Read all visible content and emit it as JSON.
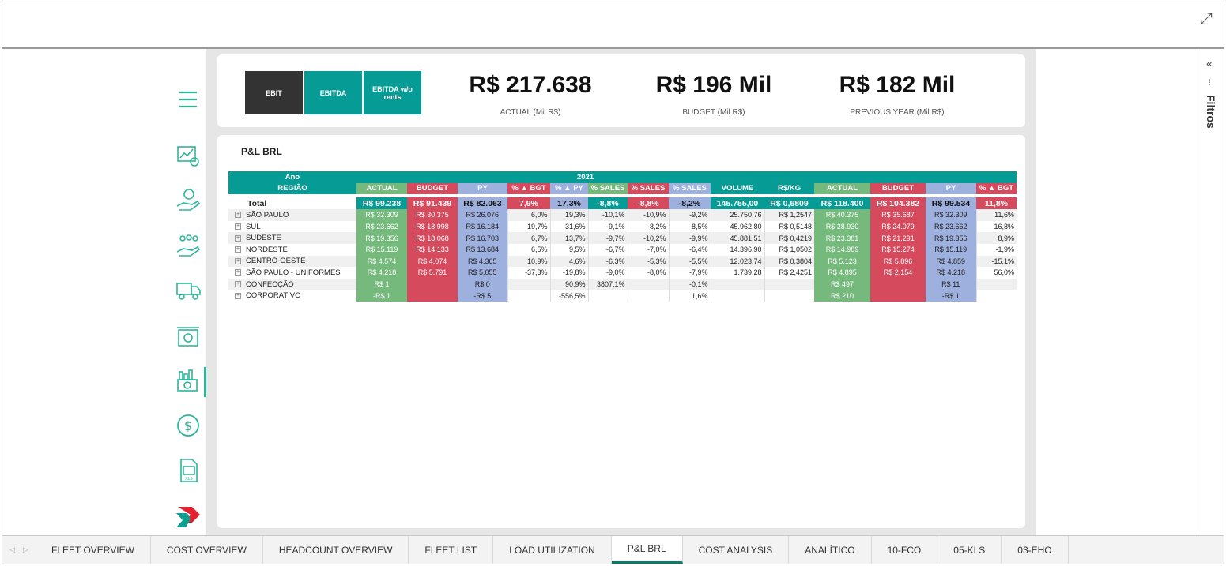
{
  "tabs_bar": [
    "FLEET OVERVIEW",
    "COST OVERVIEW",
    "HEADCOUNT OVERVIEW",
    "FLEET LIST",
    "LOAD UTILIZATION",
    "P&L BRL",
    "COST ANALYSIS",
    "ANALÍTICO",
    "10-FCO",
    "05-KLS",
    "03-EHO"
  ],
  "active_tab": "P&L BRL",
  "filters_label": "Filtros",
  "metric_buttons": {
    "ebit": "EBIT",
    "ebitda": "EBITDA",
    "ebitda_wo": "EBITDA w/o rents"
  },
  "kpis": {
    "actual": {
      "value": "R$ 217.638",
      "label": "ACTUAL (Mil R$)"
    },
    "budget": {
      "value": "R$ 196 Mil",
      "label": "BUDGET (Mil R$)"
    },
    "previous": {
      "value": "R$ 182 Mil",
      "label": "PREVIOUS YEAR (Mil R$)"
    }
  },
  "panel_title": "P&L BRL",
  "table": {
    "ano_label": "Ano",
    "regiao_label": "REGIÃO",
    "year": "2021",
    "headers": [
      "ACTUAL",
      "BUDGET",
      "PY",
      "% ▲ BGT",
      "% ▲ PY",
      "% SALES",
      "% SALES",
      "% SALES",
      "VOLUME",
      "R$/KG",
      "ACTUAL",
      "BUDGET",
      "PY",
      "% ▲ BGT"
    ],
    "total": {
      "label": "Total",
      "cells": [
        "R$ 99.238",
        "R$ 91.439",
        "R$ 82.063",
        "7,9%",
        "17,3%",
        "-8,8%",
        "-8,8%",
        "-8,2%",
        "145.755,00",
        "R$ 0,6809",
        "R$ 118.400",
        "R$ 104.382",
        "R$ 99.534",
        "11,8%"
      ]
    },
    "rows": [
      {
        "label": "SÃO PAULO",
        "cells": [
          "R$ 32.309",
          "R$ 30.375",
          "R$ 26.076",
          "6,0%",
          "19,3%",
          "-10,1%",
          "-10,9%",
          "-9,2%",
          "25.750,76",
          "R$ 1,2547",
          "R$ 40.375",
          "R$ 35.687",
          "R$ 32.309",
          "11,6%"
        ]
      },
      {
        "label": "SUL",
        "cells": [
          "R$ 23.662",
          "R$ 18.998",
          "R$ 16.184",
          "19,7%",
          "31,6%",
          "-9,1%",
          "-8,2%",
          "-8,5%",
          "45.962,80",
          "R$ 0,5148",
          "R$ 28.930",
          "R$ 24.079",
          "R$ 23.662",
          "16,8%"
        ]
      },
      {
        "label": "SUDESTE",
        "cells": [
          "R$ 19.356",
          "R$ 18.068",
          "R$ 16.703",
          "6,7%",
          "13,7%",
          "-9,7%",
          "-10,2%",
          "-9,9%",
          "45.881,51",
          "R$ 0,4219",
          "R$ 23.381",
          "R$ 21.291",
          "R$ 19.356",
          "8,9%"
        ]
      },
      {
        "label": "NORDESTE",
        "cells": [
          "R$ 15.119",
          "R$ 14.133",
          "R$ 13.684",
          "6,5%",
          "9,5%",
          "-6,7%",
          "-7,0%",
          "-6,4%",
          "14.396,90",
          "R$ 1,0502",
          "R$ 14.989",
          "R$ 15.274",
          "R$ 15.119",
          "-1,9%"
        ]
      },
      {
        "label": "CENTRO-OESTE",
        "cells": [
          "R$ 4.574",
          "R$ 4.074",
          "R$ 4.365",
          "10,9%",
          "4,6%",
          "-6,3%",
          "-5,3%",
          "-5,5%",
          "12.023,74",
          "R$ 0,3804",
          "R$ 5.123",
          "R$ 5.896",
          "R$ 4.859",
          "-15,1%"
        ]
      },
      {
        "label": "SÃO PAULO - UNIFORMES",
        "cells": [
          "R$ 4.218",
          "R$ 5.791",
          "R$ 5.055",
          "-37,3%",
          "-19,8%",
          "-9,0%",
          "-8,0%",
          "-7,9%",
          "1.739,28",
          "R$ 2,4251",
          "R$ 4.895",
          "R$ 2.154",
          "R$ 4.218",
          "56,0%"
        ]
      },
      {
        "label": "CONFECÇÃO",
        "cells": [
          "R$ 1",
          "",
          "R$ 0",
          "",
          "90,9%",
          "3807,1%",
          "",
          "-0,1%",
          "",
          "",
          "R$ 497",
          "",
          "R$ 11",
          ""
        ]
      },
      {
        "label": "CORPORATIVO",
        "cells": [
          "-R$ 1",
          "",
          "-R$ 5",
          "",
          "-556,5%",
          "",
          "",
          "1,6%",
          "",
          "",
          "R$ 210",
          "",
          "-R$ 1",
          ""
        ]
      }
    ]
  },
  "colors": {
    "teal": "#079b96",
    "green": "#76b97d",
    "red": "#d64a5d",
    "blue": "#9eb0de",
    "dark": "#333333",
    "accent": "#2db59a"
  }
}
